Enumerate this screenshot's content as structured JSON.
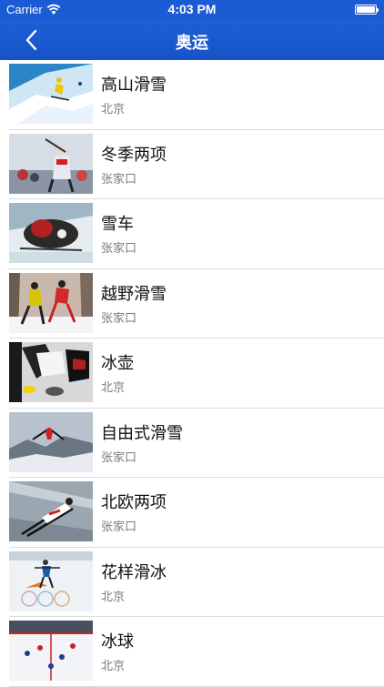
{
  "status_bar": {
    "carrier": "Carrier",
    "time": "4:03 PM",
    "icons": [
      "wifi-icon",
      "battery-icon"
    ]
  },
  "nav": {
    "title": "奥运",
    "back_icon": "chevron-left-icon",
    "color": "#1b5bd3"
  },
  "events": [
    {
      "name": "高山滑雪",
      "location": "北京",
      "thumb": "alpine-skiing-photo"
    },
    {
      "name": "冬季两项",
      "location": "张家口",
      "thumb": "biathlon-photo"
    },
    {
      "name": "雪车",
      "location": "张家口",
      "thumb": "bobsleigh-photo"
    },
    {
      "name": "越野滑雪",
      "location": "张家口",
      "thumb": "cross-country-skiing-photo"
    },
    {
      "name": "冰壶",
      "location": "北京",
      "thumb": "curling-photo"
    },
    {
      "name": "自由式滑雪",
      "location": "张家口",
      "thumb": "freestyle-skiing-photo"
    },
    {
      "name": "北欧两项",
      "location": "张家口",
      "thumb": "nordic-combined-photo"
    },
    {
      "name": "花样滑冰",
      "location": "北京",
      "thumb": "figure-skating-photo"
    },
    {
      "name": "冰球",
      "location": "北京",
      "thumb": "ice-hockey-photo"
    }
  ]
}
